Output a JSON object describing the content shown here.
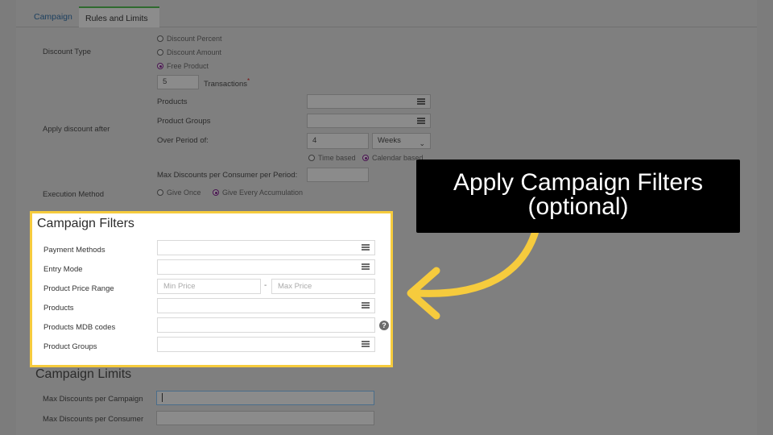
{
  "tabs": [
    {
      "label": "Campaign"
    },
    {
      "label": "Rules and Limits"
    }
  ],
  "discount_type": {
    "label": "Discount Type",
    "options": [
      {
        "label": "Discount Percent",
        "selected": false
      },
      {
        "label": "Discount Amount",
        "selected": false
      },
      {
        "label": "Free Product",
        "selected": true
      }
    ],
    "transactions_value": "5",
    "transactions_label": "Transactions",
    "required_mark": "*"
  },
  "apply_after": {
    "label": "Apply discount after",
    "products_label": "Products",
    "product_groups_label": "Product Groups",
    "period_label": "Over Period of:",
    "period_value": "4",
    "period_unit": "Weeks",
    "time_based_label": "Time based",
    "calendar_based_label": "Calendar based",
    "calendar_based_selected": true,
    "max_per_consumer_period_label": "Max Discounts per Consumer per Period:"
  },
  "execution": {
    "label": "Execution Method",
    "options": [
      {
        "label": "Give Once",
        "selected": false
      },
      {
        "label": "Give Every Accumulation",
        "selected": true
      }
    ]
  },
  "filters": {
    "title": "Campaign Filters",
    "payment_methods_label": "Payment Methods",
    "entry_mode_label": "Entry Mode",
    "price_range_label": "Product Price Range",
    "min_price_placeholder": "Min Price",
    "range_separator": "-",
    "max_price_placeholder": "Max Price",
    "products_label": "Products",
    "mdb_codes_label": "Products MDB codes",
    "help_glyph": "?",
    "product_groups_label": "Product Groups"
  },
  "limits": {
    "title": "Campaign Limits",
    "max_per_campaign_label": "Max Discounts per Campaign",
    "max_per_consumer_label": "Max Discounts per Consumer"
  },
  "callout": {
    "line1": "Apply Campaign Filters",
    "line2": "(optional)"
  },
  "colors": {
    "highlight_border": "#f6cb3d",
    "arrow": "#f6cb3d",
    "radio_selected": "#4a1452",
    "tab_active_accent": "#2f6a2f"
  }
}
